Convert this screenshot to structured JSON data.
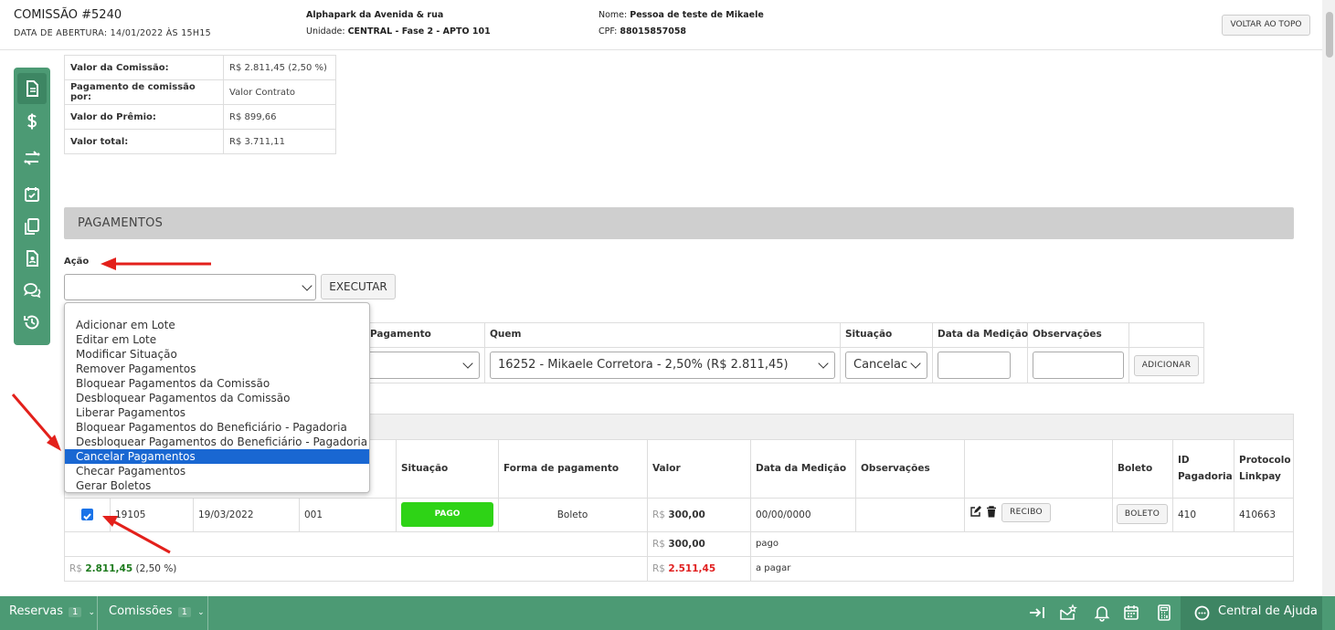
{
  "header": {
    "title": "COMISSÃO #5240",
    "opening_date": "DATA DE ABERTURA: 14/01/2022 ÀS 15H15",
    "development": "Alphapark da Avenida & rua",
    "unit_label": "Unidade:",
    "unit_value": "CENTRAL - Fase 2 - APTO 101",
    "name_label": "Nome:",
    "name_value": "Pessoa de teste de Mikaele",
    "cpf_label": "CPF:",
    "cpf_value": "88015857058",
    "back_to_top": "VOLTAR AO TOPO"
  },
  "left_toolbar": {
    "icons": [
      "document-icon",
      "dollar-icon",
      "transfer-icon",
      "calendar-check-icon",
      "copy-icon",
      "contact-file-icon",
      "chat-icon",
      "history-icon"
    ]
  },
  "summary": {
    "rows": [
      {
        "label": "Valor da Comissão:",
        "value": "R$ 2.811,45 (2,50 %)"
      },
      {
        "label": "Pagamento de comissão por:",
        "value": "Valor Contrato"
      },
      {
        "label": "Valor do Prêmio:",
        "value": "R$ 899,66"
      },
      {
        "label": "Valor total:",
        "value": "R$ 3.711,11"
      }
    ]
  },
  "payments": {
    "section_title": "PAGAMENTOS",
    "action_label": "Ação",
    "execute_button": "EXECUTAR",
    "action_options": [
      "Adicionar em Lote",
      "Editar em Lote",
      "Modificar Situação",
      "Remover Pagamentos",
      "Bloquear Pagamentos da Comissão",
      "Desbloquear Pagamentos da Comissão",
      "Liberar Pagamentos",
      "Bloquear Pagamentos do Beneficiário - Pagadoria",
      "Desbloquear Pagamentos do Beneficiário - Pagadoria",
      "Cancelar Pagamentos",
      "Checar Pagamentos",
      "Gerar Boletos"
    ],
    "highlighted_option": "Cancelar Pagamentos",
    "add_form": {
      "headers": {
        "payment": "Pagamento",
        "who": "Quem",
        "status": "Situação",
        "measurement_date": "Data da Medição",
        "notes": "Observações"
      },
      "who_value": "16252 - Mikaele Corretora - 2,50% (R$ 2.811,45)",
      "status_value": "Cancelac",
      "add_button": "ADICIONAR"
    },
    "table": {
      "headers": {
        "status": "Situação",
        "payment_method": "Forma de pagamento",
        "value": "Valor",
        "measurement_date": "Data da Medição",
        "notes": "Observações",
        "boleto": "Boleto",
        "id_pagadoria_1": "ID",
        "id_pagadoria_2": "Pagadoria",
        "protocol_1": "Protocolo",
        "protocol_2": "Linkpay"
      },
      "row": {
        "id": "19105",
        "date": "19/03/2022",
        "parcel": "001",
        "status": "PAGO",
        "payment_method": "Boleto",
        "currency": "R$",
        "value": "300,00",
        "measurement_date": "00/00/0000",
        "receipt_button": "RECIBO",
        "boleto_button": "BOLETO",
        "id_pagadoria": "410",
        "protocol": "410663",
        "checked": true
      },
      "paid_total": {
        "currency": "R$",
        "value": "300,00",
        "label": "pago"
      },
      "to_pay": {
        "currency": "R$",
        "value": "2.511,45",
        "label": "a pagar"
      },
      "commission_total": {
        "currency": "R$",
        "value": "2.811,45",
        "percent": "(2,50 %)"
      }
    }
  },
  "bottom_bar": {
    "tabs": [
      {
        "label": "Reservas",
        "count": "1"
      },
      {
        "label": "Comissões",
        "count": "1"
      }
    ],
    "help_label": "Central de Ajuda",
    "icons": [
      "sign-in-icon",
      "mail-star-icon",
      "bell-icon",
      "calendar-icon",
      "calculator-icon"
    ]
  },
  "colors": {
    "toolbar_green": "#4c9a74",
    "paid_green": "#2ed316",
    "to_pay_red": "#e02020",
    "select_blue": "#1967d2",
    "annotation_arrow_red": "#e3201b"
  }
}
